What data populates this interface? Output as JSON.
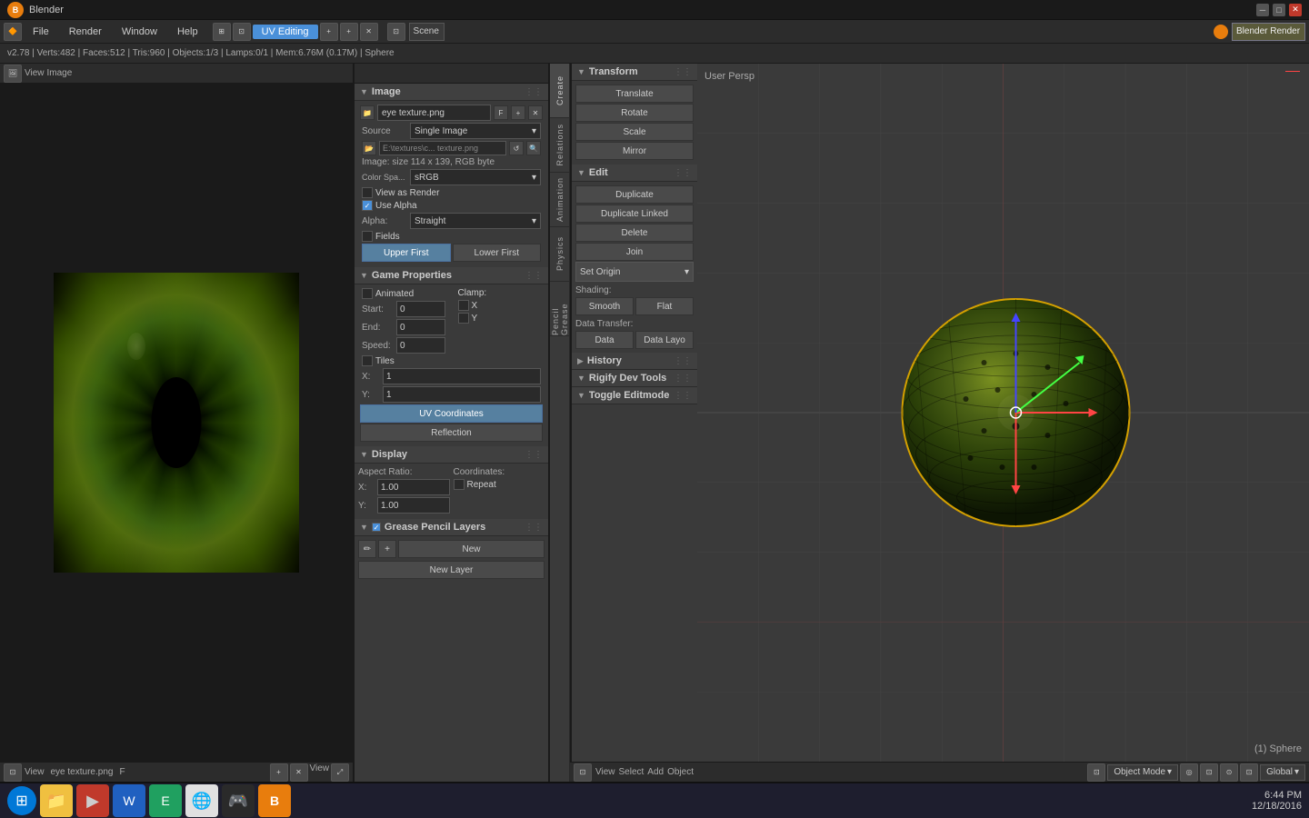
{
  "titlebar": {
    "logo": "B",
    "title": "Blender",
    "minimize": "─",
    "maximize": "□",
    "close": "✕"
  },
  "menubar": {
    "items": [
      "File",
      "Render",
      "Window",
      "Help"
    ],
    "workspace": "UV Editing",
    "scene": "Scene",
    "engine": "Blender Render"
  },
  "infobar": {
    "info": "v2.78 | Verts:482 | Faces:512 | Tris:960 | Objects:1/3 | Lamps:0/1 | Mem:6.76M (0.17M) | Sphere"
  },
  "image_panel": {
    "header_label": "Image",
    "file_name": "eye texture.png",
    "flag": "F",
    "source_label": "Source",
    "source_value": "Single Image",
    "path_label": "E:\\textures\\c...  texture.png",
    "info": "Image: size 114 x 139, RGB byte",
    "color_space_label": "Color Spa...",
    "color_space_value": "sRGB",
    "view_as_render": "View as Render",
    "use_alpha": "Use Alpha",
    "alpha_label": "Alpha:",
    "alpha_value": "Straight",
    "fields": "Fields",
    "upper_first": "Upper First",
    "lower_first": "Lower First"
  },
  "game_properties": {
    "title": "Game Properties",
    "animated": "Animated",
    "start_label": "Start:",
    "start_value": "0",
    "end_label": "End:",
    "end_value": "0",
    "speed_label": "Speed:",
    "speed_value": "0",
    "clamp_label": "Clamp:",
    "clamp_x": "X",
    "clamp_y": "Y",
    "tiles": "Tiles",
    "x_label": "X:",
    "x_value": "1",
    "y_label": "Y:",
    "y_value": "1",
    "uv_coordinates": "UV Coordinates",
    "reflection": "Reflection"
  },
  "display": {
    "title": "Display",
    "aspect_ratio": "Aspect Ratio:",
    "x_label": "X:",
    "x_value": "1.00",
    "y_label": "Y:",
    "y_value": "1.00",
    "coordinates": "Coordinates:",
    "repeat": "Repeat"
  },
  "grease_pencil": {
    "title": "Grease Pencil Layers",
    "new_label": "New",
    "new_layer": "New Layer"
  },
  "vtabs": {
    "items": [
      "Create",
      "Relations",
      "Animation",
      "Physics",
      "Grease Pencil"
    ]
  },
  "transform": {
    "title": "Transform",
    "translate": "Translate",
    "rotate": "Rotate",
    "scale": "Scale",
    "mirror": "Mirror"
  },
  "edit": {
    "title": "Edit",
    "duplicate": "Duplicate",
    "duplicate_linked": "Duplicate Linked",
    "delete": "Delete",
    "join": "Join",
    "set_origin": "Set Origin",
    "shading_label": "Shading:",
    "smooth": "Smooth",
    "flat": "Flat",
    "data_transfer": "Data Transfer:",
    "data": "Data",
    "data_layo": "Data Layo"
  },
  "history": {
    "title": "History"
  },
  "rigify": {
    "title": "Rigify Dev Tools"
  },
  "toggle": {
    "title": "Toggle Editmode"
  },
  "viewport": {
    "label": "User Persp",
    "object": "(1) Sphere"
  },
  "footer": {
    "left": {
      "view": "View",
      "image": "Image",
      "filename": "eye texture.png",
      "flag": "F"
    },
    "right": {
      "view": "View",
      "select": "Select",
      "add": "Add",
      "object": "Object",
      "mode": "Object Mode",
      "global": "Global"
    }
  },
  "taskbar": {
    "time": "6:44 PM",
    "date": "12/18/2016"
  }
}
